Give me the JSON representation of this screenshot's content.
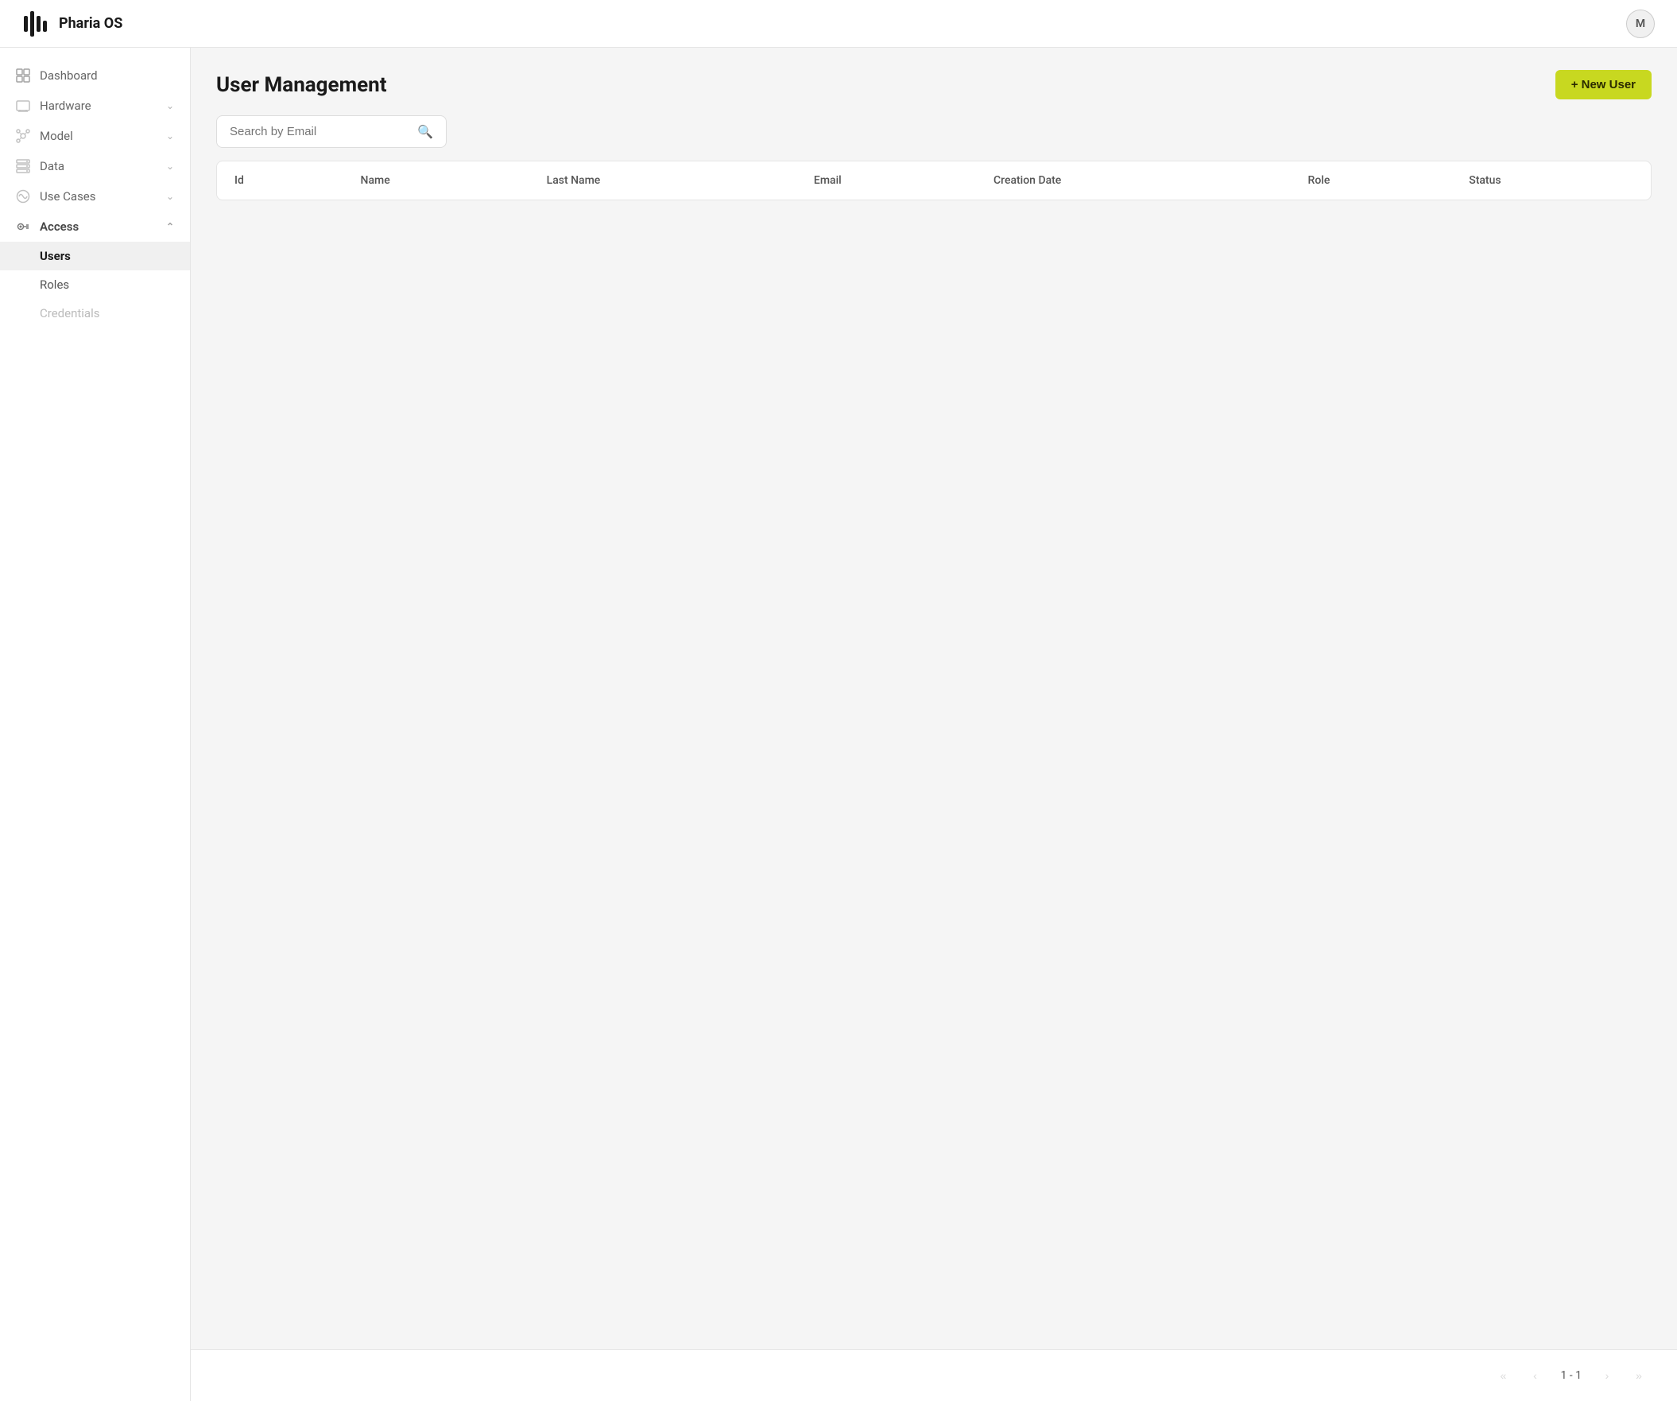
{
  "app": {
    "name": "Pharia OS",
    "avatar_initial": "M"
  },
  "sidebar": {
    "items": [
      {
        "id": "dashboard",
        "label": "Dashboard",
        "icon": "dashboard-icon",
        "expandable": false,
        "active": false
      },
      {
        "id": "hardware",
        "label": "Hardware",
        "icon": "hardware-icon",
        "expandable": true,
        "active": false
      },
      {
        "id": "model",
        "label": "Model",
        "icon": "model-icon",
        "expandable": true,
        "active": false
      },
      {
        "id": "data",
        "label": "Data",
        "icon": "data-icon",
        "expandable": true,
        "active": false
      },
      {
        "id": "use-cases",
        "label": "Use Cases",
        "icon": "use-cases-icon",
        "expandable": true,
        "active": false
      },
      {
        "id": "access",
        "label": "Access",
        "icon": "access-icon",
        "expandable": true,
        "active": true,
        "expanded": true
      }
    ],
    "sub_items": [
      {
        "id": "users",
        "label": "Users",
        "active": true,
        "disabled": false
      },
      {
        "id": "roles",
        "label": "Roles",
        "active": false,
        "disabled": false
      },
      {
        "id": "credentials",
        "label": "Credentials",
        "active": false,
        "disabled": true
      }
    ]
  },
  "page": {
    "title": "User Management",
    "new_user_button": "+ New User"
  },
  "search": {
    "placeholder": "Search by Email"
  },
  "table": {
    "columns": [
      "Id",
      "Name",
      "Last Name",
      "Email",
      "Creation Date",
      "Role",
      "Status"
    ],
    "rows": []
  },
  "pagination": {
    "info": "1 - 1",
    "first_label": "«",
    "prev_label": "‹",
    "next_label": "›",
    "last_label": "»"
  }
}
